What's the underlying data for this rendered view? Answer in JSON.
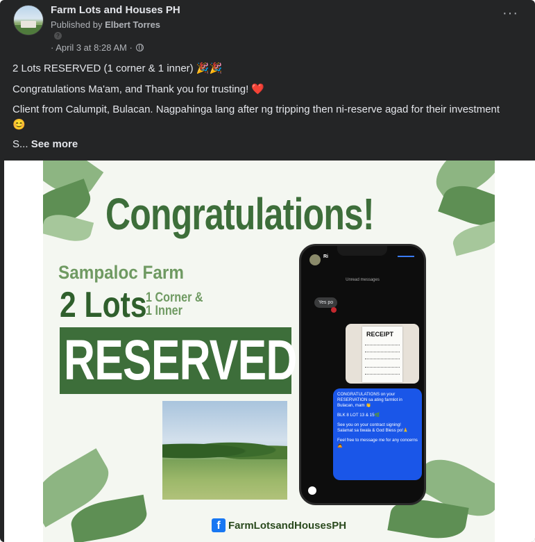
{
  "post": {
    "page_name": "Farm Lots and Houses PH",
    "published_prefix": "Published by",
    "publisher": "Elbert Torres",
    "qmark": "?",
    "timestamp": "· April 3 at 8:28 AM ·",
    "more_icon": "···",
    "lines": {
      "l1": "2 Lots RESERVED (1 corner & 1 inner) 🎉🎉",
      "l2": "Congratulations Ma'am, and Thank you for trusting! ❤️",
      "l3": "Client from Calumpit, Bulacan. Nagpahinga lang after ng tripping then ni-reserve agad for their investment😊",
      "l4_prefix": "S...",
      "see_more": "See more"
    }
  },
  "poster": {
    "headline": "Congratulations!",
    "farm": "Sampaloc Farm",
    "lots": "2 Lots",
    "lots_detail_1": "1 Corner &",
    "lots_detail_2": "1 Inner",
    "reserved": "RESERVED",
    "footer_icon": "f",
    "footer": "FarmLotsandHousesPH",
    "colors": {
      "dark_green": "#3d6e3a",
      "light_green": "#6f9a62",
      "bg": "#f4f7f1"
    }
  },
  "phone": {
    "contact": "Ri",
    "unread": "Unread messages",
    "incoming": "Yes po",
    "receipt_title": "RECEIPT",
    "outgoing": [
      "CONGRATULATIONS on your RESERVATION sa ating farmlot in Bulacan, mam 👏",
      "BLK 8 LOT 13 & 15🌿",
      "See you on your contract signing! Salamat sa tiwala & God Bless po!🙏",
      "Feel free to message me for any concerns 🙇"
    ]
  }
}
